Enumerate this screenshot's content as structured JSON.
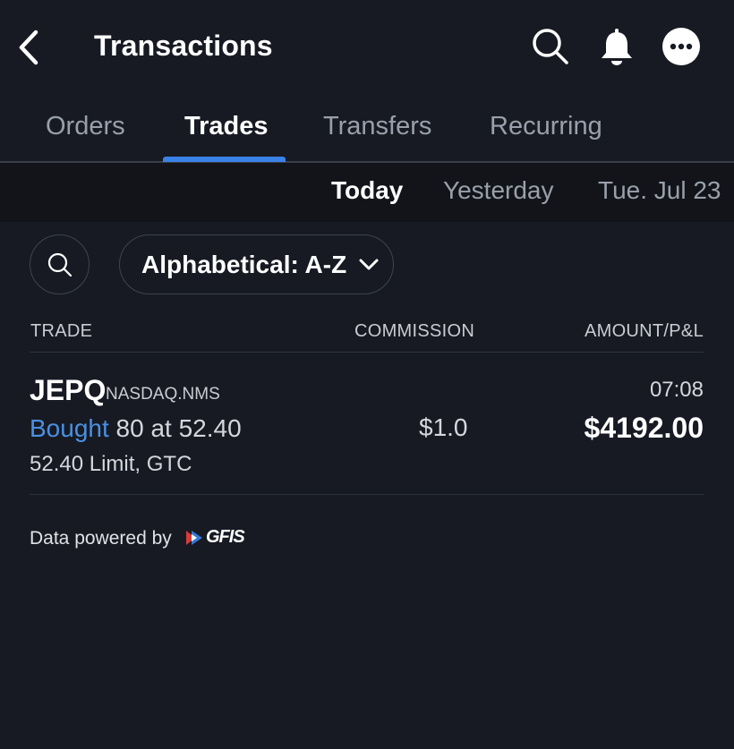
{
  "header": {
    "title": "Transactions",
    "back_icon": "chevron-left-icon",
    "search_icon": "search-icon",
    "bell_icon": "bell-icon",
    "more_icon": "more-icon"
  },
  "tabs": [
    {
      "label": "Orders",
      "active": false
    },
    {
      "label": "Trades",
      "active": true
    },
    {
      "label": "Transfers",
      "active": false
    },
    {
      "label": "Recurring",
      "active": false
    }
  ],
  "dates": [
    {
      "label": "Today",
      "active": true
    },
    {
      "label": "Yesterday",
      "active": false
    },
    {
      "label": "Tue. Jul 23",
      "active": false
    }
  ],
  "filter": {
    "sort_label": "Alphabetical: A-Z"
  },
  "columns": {
    "trade": "TRADE",
    "commission": "COMMISSION",
    "amount": "AMOUNT/P&L"
  },
  "trades": [
    {
      "symbol": "JEPQ",
      "exchange": "NASDAQ.NMS",
      "action": "Bought",
      "quantity_price": "80 at 52.40",
      "order_detail": "52.40 Limit, GTC",
      "commission": "$1.0",
      "time": "07:08",
      "amount": "$4192.00"
    }
  ],
  "footer": {
    "powered_by": "Data powered by",
    "provider": "GFIS"
  },
  "colors": {
    "background": "#171a23",
    "accent": "#3b82e6",
    "action_link": "#4a90e2"
  }
}
